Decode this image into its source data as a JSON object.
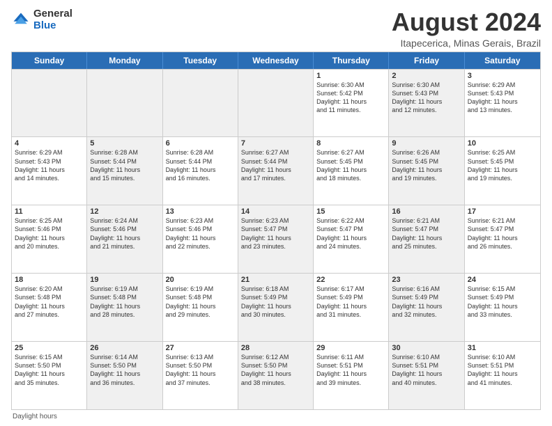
{
  "logo": {
    "line1": "General",
    "line2": "Blue"
  },
  "title": "August 2024",
  "subtitle": "Itapecerica, Minas Gerais, Brazil",
  "header_days": [
    "Sunday",
    "Monday",
    "Tuesday",
    "Wednesday",
    "Thursday",
    "Friday",
    "Saturday"
  ],
  "weeks": [
    [
      {
        "day": "",
        "info": "",
        "shade": true
      },
      {
        "day": "",
        "info": "",
        "shade": true
      },
      {
        "day": "",
        "info": "",
        "shade": true
      },
      {
        "day": "",
        "info": "",
        "shade": true
      },
      {
        "day": "1",
        "info": "Sunrise: 6:30 AM\nSunset: 5:42 PM\nDaylight: 11 hours\nand 11 minutes.",
        "shade": false
      },
      {
        "day": "2",
        "info": "Sunrise: 6:30 AM\nSunset: 5:43 PM\nDaylight: 11 hours\nand 12 minutes.",
        "shade": true
      },
      {
        "day": "3",
        "info": "Sunrise: 6:29 AM\nSunset: 5:43 PM\nDaylight: 11 hours\nand 13 minutes.",
        "shade": false
      }
    ],
    [
      {
        "day": "4",
        "info": "Sunrise: 6:29 AM\nSunset: 5:43 PM\nDaylight: 11 hours\nand 14 minutes.",
        "shade": false
      },
      {
        "day": "5",
        "info": "Sunrise: 6:28 AM\nSunset: 5:44 PM\nDaylight: 11 hours\nand 15 minutes.",
        "shade": true
      },
      {
        "day": "6",
        "info": "Sunrise: 6:28 AM\nSunset: 5:44 PM\nDaylight: 11 hours\nand 16 minutes.",
        "shade": false
      },
      {
        "day": "7",
        "info": "Sunrise: 6:27 AM\nSunset: 5:44 PM\nDaylight: 11 hours\nand 17 minutes.",
        "shade": true
      },
      {
        "day": "8",
        "info": "Sunrise: 6:27 AM\nSunset: 5:45 PM\nDaylight: 11 hours\nand 18 minutes.",
        "shade": false
      },
      {
        "day": "9",
        "info": "Sunrise: 6:26 AM\nSunset: 5:45 PM\nDaylight: 11 hours\nand 19 minutes.",
        "shade": true
      },
      {
        "day": "10",
        "info": "Sunrise: 6:25 AM\nSunset: 5:45 PM\nDaylight: 11 hours\nand 19 minutes.",
        "shade": false
      }
    ],
    [
      {
        "day": "11",
        "info": "Sunrise: 6:25 AM\nSunset: 5:46 PM\nDaylight: 11 hours\nand 20 minutes.",
        "shade": false
      },
      {
        "day": "12",
        "info": "Sunrise: 6:24 AM\nSunset: 5:46 PM\nDaylight: 11 hours\nand 21 minutes.",
        "shade": true
      },
      {
        "day": "13",
        "info": "Sunrise: 6:23 AM\nSunset: 5:46 PM\nDaylight: 11 hours\nand 22 minutes.",
        "shade": false
      },
      {
        "day": "14",
        "info": "Sunrise: 6:23 AM\nSunset: 5:47 PM\nDaylight: 11 hours\nand 23 minutes.",
        "shade": true
      },
      {
        "day": "15",
        "info": "Sunrise: 6:22 AM\nSunset: 5:47 PM\nDaylight: 11 hours\nand 24 minutes.",
        "shade": false
      },
      {
        "day": "16",
        "info": "Sunrise: 6:21 AM\nSunset: 5:47 PM\nDaylight: 11 hours\nand 25 minutes.",
        "shade": true
      },
      {
        "day": "17",
        "info": "Sunrise: 6:21 AM\nSunset: 5:47 PM\nDaylight: 11 hours\nand 26 minutes.",
        "shade": false
      }
    ],
    [
      {
        "day": "18",
        "info": "Sunrise: 6:20 AM\nSunset: 5:48 PM\nDaylight: 11 hours\nand 27 minutes.",
        "shade": false
      },
      {
        "day": "19",
        "info": "Sunrise: 6:19 AM\nSunset: 5:48 PM\nDaylight: 11 hours\nand 28 minutes.",
        "shade": true
      },
      {
        "day": "20",
        "info": "Sunrise: 6:19 AM\nSunset: 5:48 PM\nDaylight: 11 hours\nand 29 minutes.",
        "shade": false
      },
      {
        "day": "21",
        "info": "Sunrise: 6:18 AM\nSunset: 5:49 PM\nDaylight: 11 hours\nand 30 minutes.",
        "shade": true
      },
      {
        "day": "22",
        "info": "Sunrise: 6:17 AM\nSunset: 5:49 PM\nDaylight: 11 hours\nand 31 minutes.",
        "shade": false
      },
      {
        "day": "23",
        "info": "Sunrise: 6:16 AM\nSunset: 5:49 PM\nDaylight: 11 hours\nand 32 minutes.",
        "shade": true
      },
      {
        "day": "24",
        "info": "Sunrise: 6:15 AM\nSunset: 5:49 PM\nDaylight: 11 hours\nand 33 minutes.",
        "shade": false
      }
    ],
    [
      {
        "day": "25",
        "info": "Sunrise: 6:15 AM\nSunset: 5:50 PM\nDaylight: 11 hours\nand 35 minutes.",
        "shade": false
      },
      {
        "day": "26",
        "info": "Sunrise: 6:14 AM\nSunset: 5:50 PM\nDaylight: 11 hours\nand 36 minutes.",
        "shade": true
      },
      {
        "day": "27",
        "info": "Sunrise: 6:13 AM\nSunset: 5:50 PM\nDaylight: 11 hours\nand 37 minutes.",
        "shade": false
      },
      {
        "day": "28",
        "info": "Sunrise: 6:12 AM\nSunset: 5:50 PM\nDaylight: 11 hours\nand 38 minutes.",
        "shade": true
      },
      {
        "day": "29",
        "info": "Sunrise: 6:11 AM\nSunset: 5:51 PM\nDaylight: 11 hours\nand 39 minutes.",
        "shade": false
      },
      {
        "day": "30",
        "info": "Sunrise: 6:10 AM\nSunset: 5:51 PM\nDaylight: 11 hours\nand 40 minutes.",
        "shade": true
      },
      {
        "day": "31",
        "info": "Sunrise: 6:10 AM\nSunset: 5:51 PM\nDaylight: 11 hours\nand 41 minutes.",
        "shade": false
      }
    ]
  ],
  "footer": "Daylight hours"
}
